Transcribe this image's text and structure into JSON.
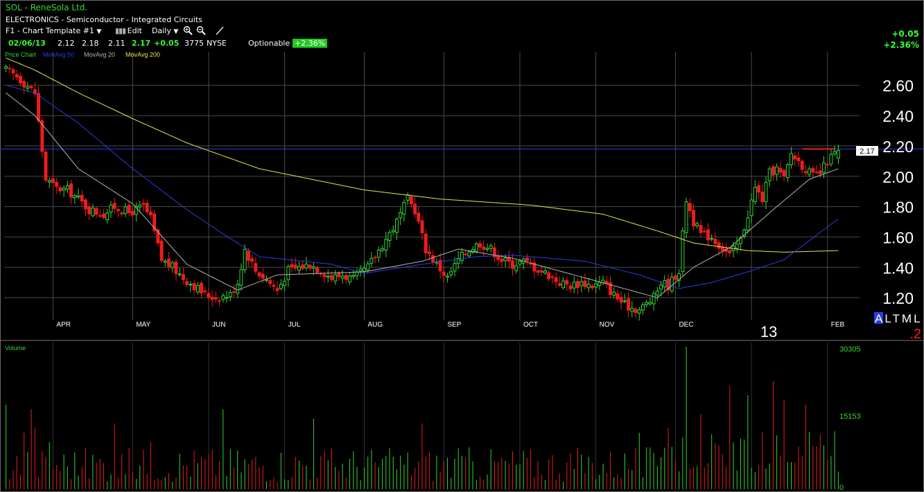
{
  "window": {
    "title": "SOL - ReneSola Ltd.",
    "industry": "ELECTRONICS - Semiconductor - Integrated Circuits"
  },
  "toolbar": {
    "template": "F1 - Chart Template #1",
    "edit_label": "Edit",
    "period": "Daily"
  },
  "quote": {
    "date": "02/06/13",
    "open": "2.12",
    "high": "2.18",
    "low": "2.11",
    "last": "2.17",
    "change": "+0.05",
    "volume": "3775",
    "exchange": "NYSE",
    "optionable_label": "Optionable",
    "pct_change": "+2.36%"
  },
  "summary": {
    "change": "+0.05",
    "pct_change": "+2.36%"
  },
  "indicators": {
    "price_label": "Price Chart",
    "ma50": "MovAvg 50",
    "ma20": "MovAvg 20",
    "ma200": "MovAvg 200",
    "volume_label": "Volume"
  },
  "colors": {
    "up": "#33d833",
    "down": "#ee1c1c",
    "ma20": "#b4b4b4",
    "ma50": "#2a3ee8",
    "ma200": "#e6e64a",
    "grid": "#4a4a4a"
  },
  "chart_data": {
    "type": "candlestick",
    "price_axis": {
      "min": 1.05,
      "max": 2.82,
      "ticks": [
        1.2,
        1.4,
        1.6,
        1.8,
        2.0,
        2.2,
        2.4,
        2.6
      ]
    },
    "price_tick_labels": [
      "1.20",
      "1.40",
      "1.60",
      "1.80",
      "2.00",
      "2.20",
      "2.40",
      "2.60"
    ],
    "months": [
      {
        "label": "APR",
        "index": 13
      },
      {
        "label": "MAY",
        "index": 35
      },
      {
        "label": "JUN",
        "index": 56
      },
      {
        "label": "JUL",
        "index": 77
      },
      {
        "label": "AUG",
        "index": 99
      },
      {
        "label": "SEP",
        "index": 121
      },
      {
        "label": "OCT",
        "index": 142
      },
      {
        "label": "NOV",
        "index": 163
      },
      {
        "label": "DEC",
        "index": 185
      },
      {
        "label": "FEB",
        "index": 227
      }
    ],
    "year_label": "13",
    "year_index": 206,
    "session_count": 231,
    "reference_line": 2.18,
    "last_price_label": "2.17",
    "last_price": 2.17,
    "corner_labels": {
      "modes": "ALTML",
      "active_mode": "A",
      "value": ".2"
    },
    "anchors": [
      [
        0,
        2.7
      ],
      [
        3,
        2.66
      ],
      [
        8,
        2.55
      ],
      [
        11,
        1.98
      ],
      [
        14,
        1.92
      ],
      [
        17,
        1.91
      ],
      [
        20,
        1.85
      ],
      [
        23,
        1.78
      ],
      [
        27,
        1.75
      ],
      [
        30,
        1.8
      ],
      [
        34,
        1.76
      ],
      [
        38,
        1.8
      ],
      [
        40,
        1.72
      ],
      [
        43,
        1.45
      ],
      [
        46,
        1.4
      ],
      [
        49,
        1.33
      ],
      [
        52,
        1.28
      ],
      [
        55,
        1.22
      ],
      [
        58,
        1.2
      ],
      [
        62,
        1.22
      ],
      [
        64,
        1.3
      ],
      [
        66,
        1.52
      ],
      [
        69,
        1.38
      ],
      [
        72,
        1.32
      ],
      [
        75,
        1.25
      ],
      [
        78,
        1.38
      ],
      [
        81,
        1.4
      ],
      [
        84,
        1.42
      ],
      [
        87,
        1.38
      ],
      [
        90,
        1.33
      ],
      [
        93,
        1.35
      ],
      [
        96,
        1.32
      ],
      [
        100,
        1.4
      ],
      [
        104,
        1.55
      ],
      [
        108,
        1.7
      ],
      [
        111,
        1.85
      ],
      [
        113,
        1.78
      ],
      [
        116,
        1.52
      ],
      [
        119,
        1.42
      ],
      [
        122,
        1.33
      ],
      [
        125,
        1.45
      ],
      [
        128,
        1.52
      ],
      [
        131,
        1.56
      ],
      [
        134,
        1.52
      ],
      [
        137,
        1.45
      ],
      [
        140,
        1.42
      ],
      [
        143,
        1.44
      ],
      [
        146,
        1.4
      ],
      [
        150,
        1.35
      ],
      [
        153,
        1.3
      ],
      [
        156,
        1.28
      ],
      [
        159,
        1.3
      ],
      [
        162,
        1.28
      ],
      [
        165,
        1.3
      ],
      [
        168,
        1.22
      ],
      [
        171,
        1.15
      ],
      [
        175,
        1.12
      ],
      [
        179,
        1.2
      ],
      [
        181,
        1.3
      ],
      [
        183,
        1.28
      ],
      [
        186,
        1.38
      ],
      [
        188,
        1.85
      ],
      [
        190,
        1.7
      ],
      [
        192,
        1.62
      ],
      [
        195,
        1.6
      ],
      [
        197,
        1.55
      ],
      [
        200,
        1.48
      ],
      [
        203,
        1.58
      ],
      [
        205,
        1.75
      ],
      [
        207,
        1.92
      ],
      [
        209,
        1.85
      ],
      [
        211,
        2.02
      ],
      [
        213,
        2.05
      ],
      [
        215,
        1.98
      ],
      [
        217,
        2.15
      ],
      [
        219,
        2.1
      ],
      [
        221,
        2.05
      ],
      [
        223,
        2.0
      ],
      [
        225,
        2.02
      ],
      [
        227,
        2.1
      ],
      [
        229,
        2.15
      ],
      [
        230,
        2.17
      ]
    ],
    "ma20": [
      [
        0,
        2.55
      ],
      [
        8,
        2.4
      ],
      [
        20,
        2.05
      ],
      [
        35,
        1.82
      ],
      [
        50,
        1.42
      ],
      [
        64,
        1.25
      ],
      [
        75,
        1.35
      ],
      [
        99,
        1.37
      ],
      [
        115,
        1.44
      ],
      [
        125,
        1.52
      ],
      [
        140,
        1.46
      ],
      [
        160,
        1.33
      ],
      [
        180,
        1.2
      ],
      [
        190,
        1.4
      ],
      [
        200,
        1.53
      ],
      [
        212,
        1.78
      ],
      [
        222,
        1.98
      ],
      [
        230,
        2.05
      ]
    ],
    "ma50": [
      [
        0,
        2.6
      ],
      [
        8,
        2.55
      ],
      [
        20,
        2.35
      ],
      [
        35,
        2.05
      ],
      [
        50,
        1.78
      ],
      [
        60,
        1.62
      ],
      [
        70,
        1.47
      ],
      [
        90,
        1.42
      ],
      [
        99,
        1.36
      ],
      [
        115,
        1.42
      ],
      [
        130,
        1.47
      ],
      [
        140,
        1.48
      ],
      [
        160,
        1.44
      ],
      [
        175,
        1.35
      ],
      [
        186,
        1.26
      ],
      [
        195,
        1.3
      ],
      [
        205,
        1.37
      ],
      [
        215,
        1.45
      ],
      [
        230,
        1.72
      ]
    ],
    "ma200": [
      [
        0,
        2.78
      ],
      [
        8,
        2.7
      ],
      [
        20,
        2.55
      ],
      [
        35,
        2.38
      ],
      [
        50,
        2.22
      ],
      [
        70,
        2.05
      ],
      [
        99,
        1.91
      ],
      [
        120,
        1.85
      ],
      [
        145,
        1.81
      ],
      [
        165,
        1.75
      ],
      [
        180,
        1.64
      ],
      [
        190,
        1.56
      ],
      [
        205,
        1.51
      ],
      [
        215,
        1.5
      ],
      [
        230,
        1.51
      ]
    ],
    "volume": {
      "axis_max": 30305,
      "tick_labels": [
        "30305",
        "15153",
        "0"
      ],
      "spikes": [
        [
          0,
          18000
        ],
        [
          5,
          12000
        ],
        [
          7,
          17000
        ],
        [
          8,
          13000
        ],
        [
          12,
          10000
        ],
        [
          30,
          14000
        ],
        [
          40,
          10000
        ],
        [
          60,
          17000
        ],
        [
          85,
          15000
        ],
        [
          115,
          14000
        ],
        [
          175,
          12000
        ],
        [
          183,
          13000
        ],
        [
          188,
          30305
        ],
        [
          192,
          16000
        ],
        [
          200,
          22000
        ],
        [
          205,
          20000
        ],
        [
          212,
          23000
        ],
        [
          215,
          19000
        ],
        [
          221,
          18000
        ]
      ]
    }
  }
}
